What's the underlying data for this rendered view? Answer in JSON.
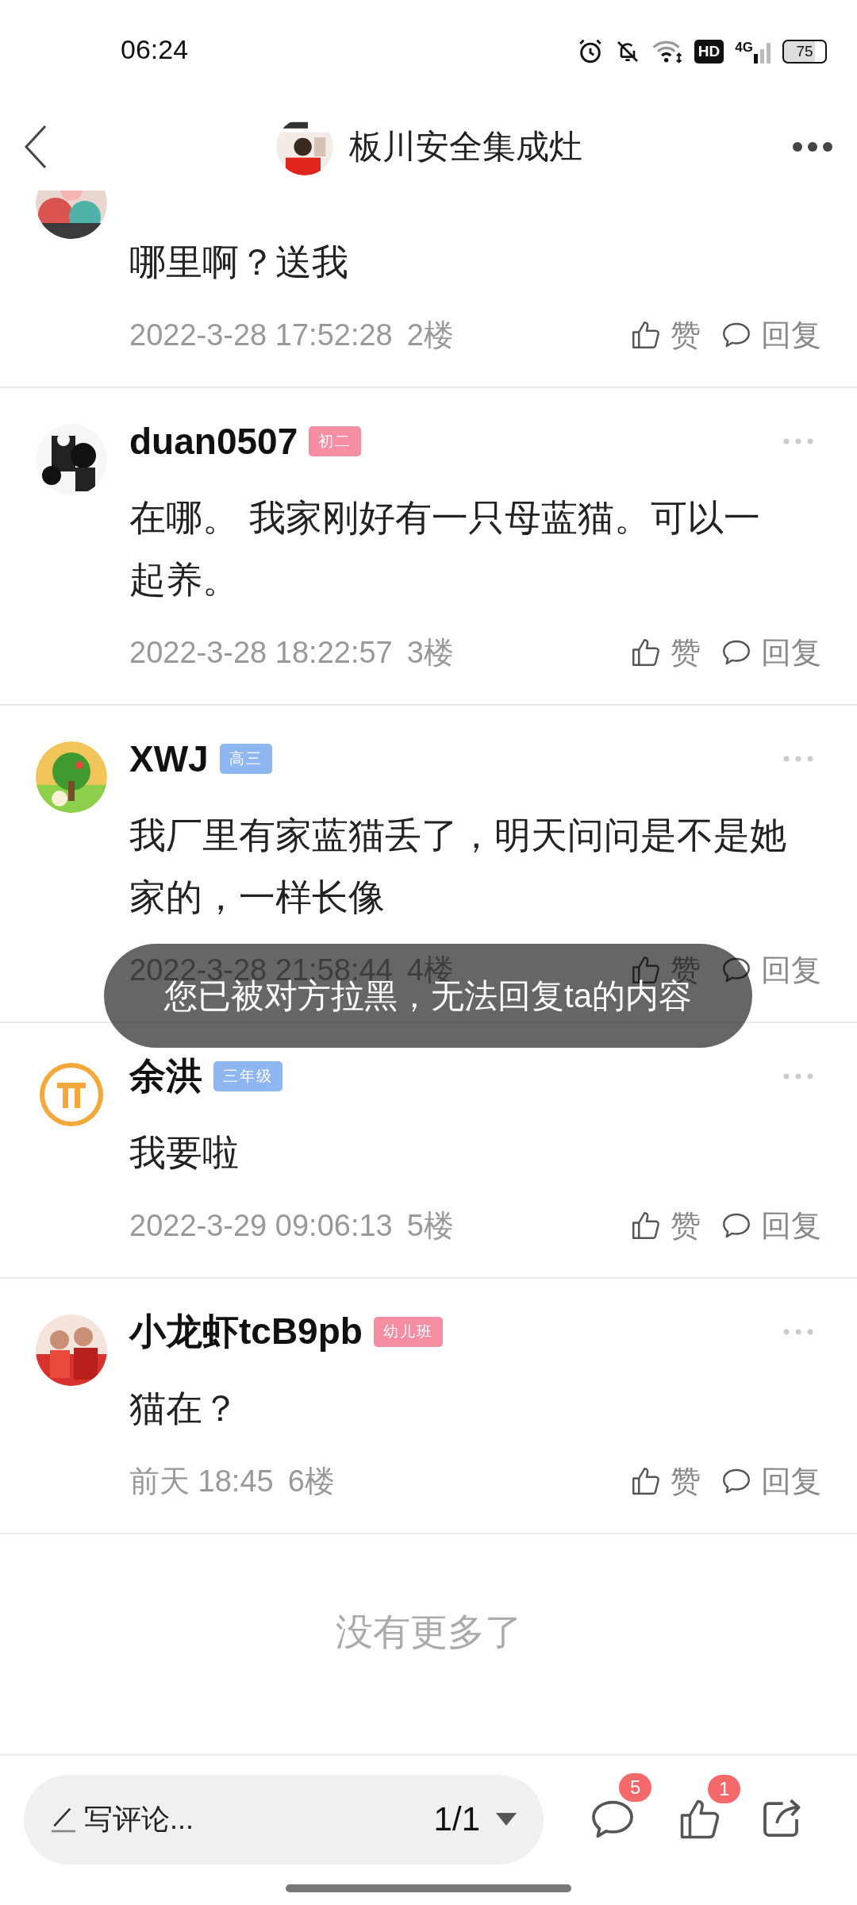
{
  "status_bar": {
    "time": "06:24",
    "hd": "HD",
    "network": "4G",
    "battery": "75"
  },
  "header": {
    "title": "板川安全集成灶"
  },
  "comments": [
    {
      "body": "哪里啊？送我",
      "time": "2022-3-28 17:52:28",
      "floor": "2楼",
      "like": "赞",
      "reply": "回复"
    },
    {
      "name": "duan0507",
      "tag": {
        "label": "初二",
        "color": "#f58ea3"
      },
      "body": "在哪。 我家刚好有一只母蓝猫。可以一起养。",
      "time": "2022-3-28 18:22:57",
      "floor": "3楼",
      "like": "赞",
      "reply": "回复"
    },
    {
      "name": "XWJ",
      "tag": {
        "label": "高三",
        "color": "#8fb6f0"
      },
      "body": "我厂里有家蓝猫丢了，明天问问是不是她家的，一样长像",
      "time": "2022-3-28 21:58:44",
      "floor": "4楼",
      "like": "赞",
      "reply": "回复"
    },
    {
      "name": "余洪",
      "tag": {
        "label": "三年级",
        "color": "#8fb6f0"
      },
      "body": "我要啦",
      "time": "2022-3-29 09:06:13",
      "floor": "5楼",
      "like": "赞",
      "reply": "回复"
    },
    {
      "name": "小龙虾tcB9pb",
      "tag": {
        "label": "幼儿班",
        "color": "#f58ea3"
      },
      "body": "猫在？",
      "time": "前天 18:45",
      "floor": "6楼",
      "like": "赞",
      "reply": "回复"
    }
  ],
  "end_note": "没有更多了",
  "toast": "您已被对方拉黑，无法回复ta的内容",
  "bottom_bar": {
    "placeholder": "写评论...",
    "page": "1/1",
    "comment_count": "5",
    "like_count": "1"
  }
}
